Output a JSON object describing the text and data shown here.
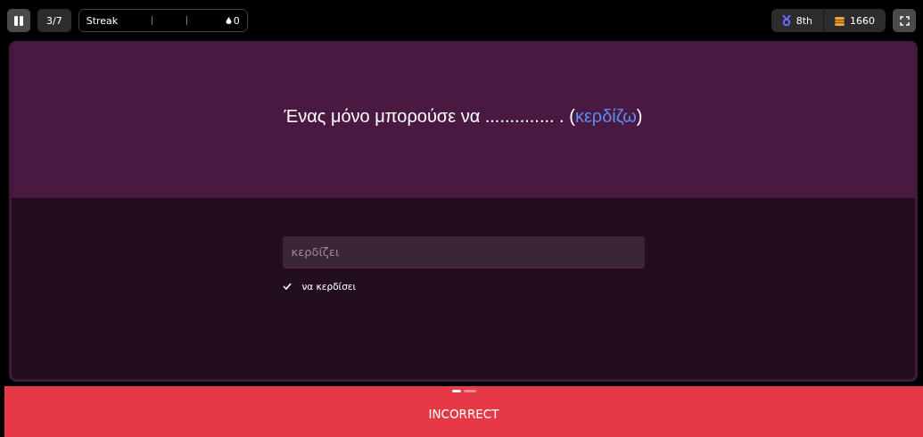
{
  "top_bar": {
    "progress": "3/7",
    "streak": {
      "label": "Streak",
      "count": "0"
    },
    "rank": "8th",
    "coins": "1660"
  },
  "question": {
    "segments": [
      {
        "kind": "plain",
        "text": "Ένας μόνο μπορούσε να .............. . ("
      },
      {
        "kind": "hint",
        "text": "κερδίζω"
      },
      {
        "kind": "plain",
        "text": ")"
      }
    ]
  },
  "answer": {
    "value": "κερδίζει",
    "correct": false,
    "correct_answer": "να κερδίσει"
  },
  "pager": [
    {
      "selected": true
    },
    {
      "selected": false
    }
  ],
  "result": {
    "label": "INCORRECT",
    "kind": "incorrect"
  }
}
